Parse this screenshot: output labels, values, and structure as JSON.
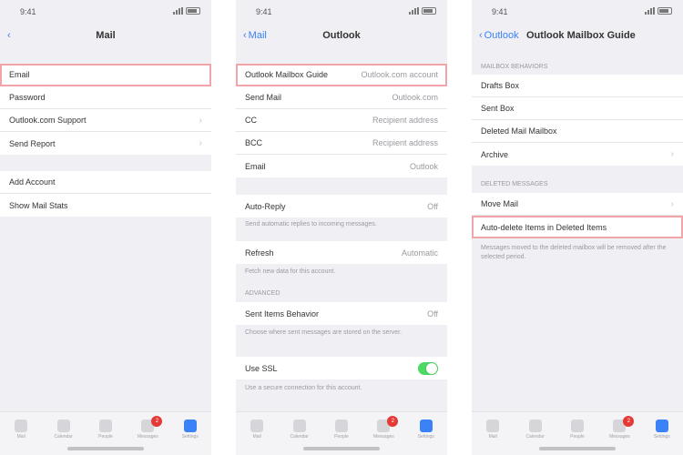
{
  "screens": [
    {
      "status_time": "9:41",
      "nav": {
        "back": "",
        "title": "Mail"
      },
      "group1": [
        "Email",
        "Password",
        "Outlook.com Support",
        "Send Report"
      ],
      "group2": [
        "Add Account",
        "Show Mail Stats"
      ]
    },
    {
      "status_time": "9:41",
      "nav": {
        "back": "Mail",
        "title": "Outlook"
      },
      "group1": [
        {
          "label": "Outlook Mailbox Guide",
          "value": "Outlook.com account"
        },
        {
          "label": "Send Mail",
          "value": "Outlook.com"
        },
        {
          "label": "CC",
          "value": "Recipient address"
        },
        {
          "label": "BCC",
          "value": "Recipient address"
        },
        {
          "label": "Email",
          "value": "Outlook"
        }
      ],
      "single1": {
        "label": "Auto-Reply",
        "value": "Off"
      },
      "note1": "Send automatic replies to incoming messages.",
      "single2": {
        "label": "Refresh",
        "value": "Automatic"
      },
      "note2": "Fetch new data for this account.",
      "section_header": "ADVANCED",
      "single3": {
        "label": "Sent Items Behavior",
        "value": "Off"
      },
      "note3": "Choose where sent messages are stored on the server.",
      "single4": {
        "label": "Use SSL"
      },
      "note4": "Use a secure connection for this account."
    },
    {
      "status_time": "9:41",
      "nav": {
        "back": "Outlook",
        "title": "Outlook Mailbox Guide"
      },
      "header": "MAILBOX BEHAVIORS",
      "group1": [
        "Drafts Box",
        "Sent Box",
        "Deleted Mail Mailbox",
        "Archive"
      ],
      "header2": "DELETED MESSAGES",
      "group2": [
        "Move Mail",
        "Auto-delete Items in Deleted Items"
      ],
      "note": "Messages moved to the deleted mailbox will be removed after the selected period."
    }
  ],
  "tabs": [
    {
      "name": "tab-mail",
      "label": "Mail"
    },
    {
      "name": "tab-calendar",
      "label": "Calendar"
    },
    {
      "name": "tab-people",
      "label": "People"
    },
    {
      "name": "tab-messages",
      "label": "Messages",
      "badge": "2"
    },
    {
      "name": "tab-settings",
      "label": "Settings"
    }
  ]
}
